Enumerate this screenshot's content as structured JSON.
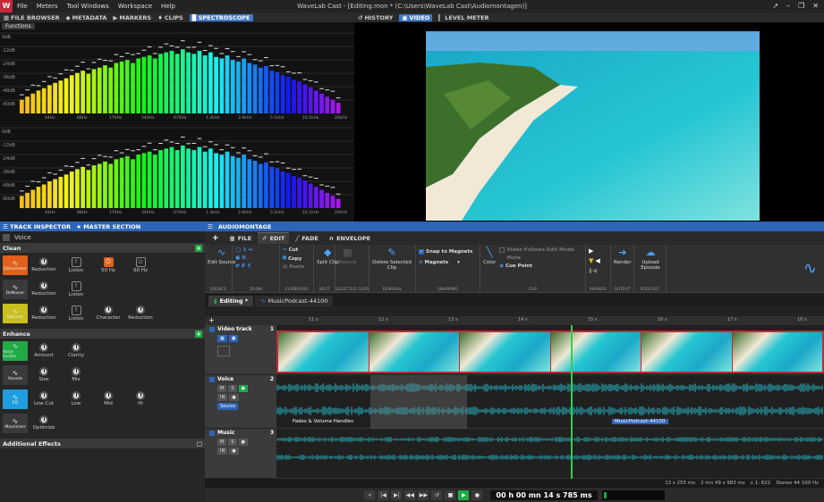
{
  "app": {
    "title": "WaveLab Cast - [Editing.mon * (C:\\Users\\WaveLab Cast\\Audiomontagen)]",
    "logo": "W",
    "menu": [
      "File",
      "Meters",
      "Tool Windows",
      "Workspace",
      "Help"
    ],
    "window_buttons": [
      "↗",
      "–",
      "❐",
      "✕"
    ]
  },
  "top_left_tabs": [
    "FILE BROWSER",
    "METADATA",
    "MARKERS",
    "CLIPS",
    "SPECTROSCOPE"
  ],
  "top_right_tabs": [
    "HISTORY",
    "VIDEO",
    "LEVEL METER"
  ],
  "spectroscope": {
    "functions_label": "Functions",
    "db_labels_top": [
      "0dB",
      "-12dB",
      "-24dB",
      "-36dB",
      "-48dB",
      "-60dB"
    ],
    "db_labels_bottom": [
      "0dB",
      "-12dB",
      "-24dB",
      "-36dB",
      "-48dB",
      "-60dB"
    ],
    "freq_labels": [
      "44Hz",
      "88Hz",
      "170Hz",
      "340Hz",
      "670Hz",
      "1.3kHz",
      "2.6kHz",
      "5.1kHz",
      "10.1kHz",
      "20kHz"
    ],
    "bars_top": [
      0.18,
      0.22,
      0.26,
      0.3,
      0.33,
      0.37,
      0.4,
      0.43,
      0.46,
      0.5,
      0.53,
      0.56,
      0.52,
      0.58,
      0.6,
      0.63,
      0.6,
      0.66,
      0.68,
      0.7,
      0.66,
      0.72,
      0.74,
      0.76,
      0.72,
      0.78,
      0.8,
      0.82,
      0.78,
      0.84,
      0.8,
      0.78,
      0.82,
      0.76,
      0.8,
      0.74,
      0.72,
      0.76,
      0.7,
      0.68,
      0.72,
      0.66,
      0.64,
      0.6,
      0.62,
      0.56,
      0.54,
      0.5,
      0.48,
      0.44,
      0.42,
      0.38,
      0.34,
      0.3,
      0.26,
      0.22,
      0.18,
      0.14
    ],
    "bars_bottom": [
      0.16,
      0.2,
      0.24,
      0.28,
      0.31,
      0.35,
      0.38,
      0.41,
      0.44,
      0.48,
      0.51,
      0.54,
      0.5,
      0.56,
      0.58,
      0.61,
      0.58,
      0.64,
      0.66,
      0.68,
      0.64,
      0.7,
      0.72,
      0.74,
      0.7,
      0.76,
      0.78,
      0.8,
      0.76,
      0.82,
      0.78,
      0.76,
      0.8,
      0.74,
      0.78,
      0.72,
      0.7,
      0.74,
      0.68,
      0.66,
      0.7,
      0.64,
      0.62,
      0.58,
      0.6,
      0.54,
      0.52,
      0.48,
      0.46,
      0.42,
      0.4,
      0.36,
      0.32,
      0.28,
      0.24,
      0.2,
      0.16,
      0.12
    ]
  },
  "inspector": {
    "tabs": [
      "TRACK INSPECTOR",
      "MASTER SECTION"
    ],
    "track_select": "Voice",
    "clean": {
      "title": "Clean",
      "rows": [
        {
          "plugin": "DeHummer",
          "color": "#e0601c",
          "cells": [
            "Reduction",
            "Listen",
            "50 Hz",
            "60 Hz"
          ]
        },
        {
          "plugin": "DeNoiser",
          "color": "#3a3a3a",
          "cells": [
            "Reduction",
            "Listen"
          ]
        },
        {
          "plugin": "DeEsser",
          "color": "#c8c01c",
          "cells": [
            "Reduction",
            "Listen",
            "Character",
            "Reduction"
          ]
        }
      ]
    },
    "enhance": {
      "title": "Enhance",
      "rows": [
        {
          "plugin": "Voice Exciter",
          "color": "#1eaa45",
          "cells": [
            "Amount",
            "Clarity"
          ]
        },
        {
          "plugin": "Reverb",
          "color": "#3a3a3a",
          "cells": [
            "Size",
            "Mix"
          ]
        },
        {
          "plugin": "EQ",
          "color": "#1e9ee0",
          "cells": [
            "Low Cut",
            "Low",
            "Mid",
            "Hi"
          ]
        },
        {
          "plugin": "Maximizer",
          "color": "#3a3a3a",
          "cells": [
            "Optimize"
          ]
        }
      ]
    },
    "additional": "Additional Effects"
  },
  "montage": {
    "title": "AUDIOMONTAGE",
    "ribbon_tabs": [
      "FILE",
      "EDIT",
      "FADE",
      "ENVELOPE"
    ],
    "ribbon": {
      "source": {
        "label": "Edit Source",
        "group": "SOURCE"
      },
      "zoom_group": "ZOOM",
      "clipboard": {
        "cut": "Cut",
        "copy": "Copy",
        "paste": "Paste",
        "group": "CLIPBOARD"
      },
      "split": {
        "label": "Split Clip",
        "group": "SPLIT"
      },
      "selected_clips": {
        "label": "Bounce",
        "group": "SELECTED CLIPS"
      },
      "removal": {
        "label": "Delete Selected Clip",
        "group": "REMOVAL"
      },
      "snapping": {
        "snap": "Snap to Magnets",
        "magnets": "Magnets",
        "group": "SNAPPING"
      },
      "clip": {
        "color": "Color",
        "follows": "Video Follows Edit Mode",
        "mute": "Mute",
        "cue": "Cue Point",
        "group": "CLIP"
      },
      "marker_group": "MARKER",
      "output": {
        "label": "Render",
        "group": "OUTPUT"
      },
      "podcast": {
        "label": "Upload Episode",
        "group": "PODCAST"
      }
    },
    "edit_tabs": [
      "Editing *",
      "MusicPodcast-44100"
    ],
    "ruler_labels": [
      "11 s",
      "12 s",
      "13 s",
      "14 s",
      "15 s",
      "16 s",
      "17 s",
      "18 s"
    ],
    "tracks": [
      {
        "name": "Video track",
        "num": "1"
      },
      {
        "name": "Voice",
        "num": "2",
        "controls": [
          "M",
          "S",
          "IN",
          "Source"
        ]
      },
      {
        "name": "Music",
        "num": "3",
        "controls": [
          "M",
          "S",
          "IN"
        ]
      }
    ],
    "clip_labels": {
      "fades": "Fades & Volume Handles",
      "music": "MusicPodcast-44100"
    },
    "status": [
      "13 s 255 ms",
      "2 mn 49 s 983 ms",
      "x 1: 622",
      "Stereo 44 100 Hz"
    ],
    "time_display": "00 h 00 mn 14 s 785 ms",
    "transport": [
      "«",
      "|◀",
      "▶|",
      "◀◀",
      "▶▶",
      "↺",
      "■",
      "▶",
      "●"
    ]
  },
  "colors": {
    "accent": "#2d64b7",
    "green": "#1eaa45",
    "orange": "#e0601c",
    "clip_red": "#c4283a",
    "wave": "#27b6c6"
  }
}
